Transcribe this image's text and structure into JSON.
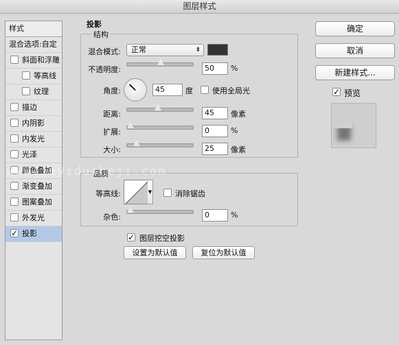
{
  "window": {
    "title": "图层样式"
  },
  "style_list": {
    "header": "样式",
    "blend_options": "混合选项:自定",
    "items": [
      {
        "label": "斜面和浮雕",
        "checked": false,
        "indent": false,
        "selected": false
      },
      {
        "label": "等高线",
        "checked": false,
        "indent": true,
        "selected": false
      },
      {
        "label": "纹理",
        "checked": false,
        "indent": true,
        "selected": false
      },
      {
        "label": "描边",
        "checked": false,
        "indent": false,
        "selected": false
      },
      {
        "label": "内阴影",
        "checked": false,
        "indent": false,
        "selected": false
      },
      {
        "label": "内发光",
        "checked": false,
        "indent": false,
        "selected": false
      },
      {
        "label": "光泽",
        "checked": false,
        "indent": false,
        "selected": false
      },
      {
        "label": "颜色叠加",
        "checked": false,
        "indent": false,
        "selected": false
      },
      {
        "label": "渐变叠加",
        "checked": false,
        "indent": false,
        "selected": false
      },
      {
        "label": "图案叠加",
        "checked": false,
        "indent": false,
        "selected": false
      },
      {
        "label": "外发光",
        "checked": false,
        "indent": false,
        "selected": false
      },
      {
        "label": "投影",
        "checked": true,
        "indent": false,
        "selected": true
      }
    ]
  },
  "drop_shadow": {
    "section_title": "投影",
    "structure": {
      "group_label": "结构",
      "blend_mode_label": "混合模式:",
      "blend_mode_value": "正常",
      "shadow_color": "#333331",
      "opacity_label": "不透明度:",
      "opacity_value": "50",
      "opacity_unit": "%",
      "opacity_level": 0.5,
      "angle_label": "角度:",
      "angle_value": "45",
      "angle_unit": "度",
      "global_light_label": "使用全局光",
      "global_light_checked": false,
      "distance_label": "距离:",
      "distance_value": "45",
      "distance_unit": "像素",
      "distance_level": 0.45,
      "spread_label": "扩展:",
      "spread_value": "0",
      "spread_unit": "%",
      "spread_level": 0.0,
      "size_label": "大小:",
      "size_value": "25",
      "size_unit": "像素",
      "size_level": 0.1
    },
    "quality": {
      "group_label": "品质",
      "contour_label": "等高线:",
      "antialias_label": "消除锯齿",
      "antialias_checked": false,
      "noise_label": "杂色:",
      "noise_value": "0",
      "noise_unit": "%",
      "noise_level": 0.0
    },
    "knockout_label": "图层挖空投影",
    "knockout_checked": true,
    "make_default_label": "设置为默认值",
    "reset_default_label": "复位为默认值"
  },
  "actions": {
    "ok_label": "确定",
    "cancel_label": "取消",
    "new_style_label": "新建样式...",
    "preview_label": "预览",
    "preview_checked": true
  },
  "watermark": "www.ieyidusheji.com"
}
